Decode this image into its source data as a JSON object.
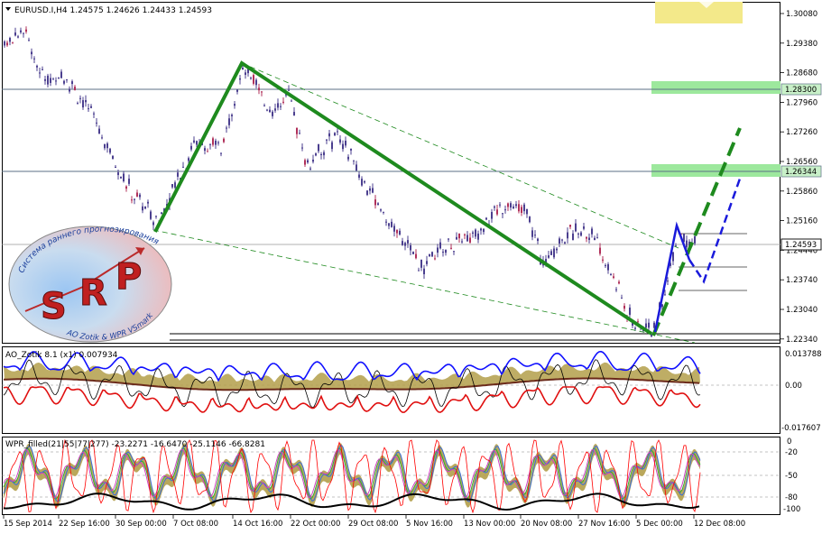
{
  "colors": {
    "background": "#ffffff",
    "grid_line": "#5b6f85",
    "candle": "#4b3f8f",
    "green_trend": "#1e8a1e",
    "blue_projection": "#1a1adb",
    "resistance_zone": "#9de89d",
    "zone_yellow": "#f3e98a",
    "ao_blue": "#1010ff",
    "ao_red": "#e01010",
    "ao_fill": "#b39f4a",
    "wpr_black": "#000000",
    "wpr_red": "#ff0000",
    "wpr_green": "#33aa33",
    "price_label_bg": "#c8f0c8"
  },
  "main_panel": {
    "header": "EURUSD.I,H4  1.24575 1.24626 1.24433 1.24593",
    "price_axis_labels": [
      "1.30080",
      "1.29380",
      "1.28680",
      "1.27960",
      "1.27260",
      "1.26560",
      "1.25860",
      "1.25160",
      "1.24440",
      "1.23740",
      "1.23040",
      "1.22340"
    ],
    "tagged_prices": {
      "level_1": "1.28300",
      "level_2": "1.26344",
      "current": "1.24593"
    },
    "logo": {
      "top_text": "Система раннего прогнозирования",
      "letters": [
        "S",
        "R",
        "P"
      ],
      "bottom_text": "AO Zotik & WPR VSmark",
      "icon": "srp-logo-icon"
    }
  },
  "ao_panel": {
    "header": "AO_Zotik 8.1 (x1) 0.007934",
    "axis_labels": [
      "0.013788",
      "0.00",
      "-0.017607"
    ]
  },
  "wpr_panel": {
    "header": "WPR_filled(21|55|77|277)  -23.2271 -16.6470 -25.1146 -66.8281",
    "axis_labels": [
      "0",
      "-20",
      "-50",
      "-80",
      "-100"
    ]
  },
  "time_axis": {
    "labels": [
      "15 Sep 2014",
      "22 Sep 16:00",
      "30 Sep 00:00",
      "7 Oct 08:00",
      "14 Oct 16:00",
      "22 Oct 00:00",
      "29 Oct 08:00",
      "5 Nov 16:00",
      "13 Nov 00:00",
      "20 Nov 08:00",
      "27 Nov 16:00",
      "5 Dec 00:00",
      "12 Dec 08:00"
    ]
  },
  "chart_data": {
    "type": "line",
    "symbol": "EURUSD.I",
    "timeframe": "H4",
    "last_bar": {
      "open": 1.24575,
      "high": 1.24626,
      "low": 1.24433,
      "close": 1.24593
    },
    "ylim": [
      1.2234,
      1.3008
    ],
    "anchor_price_points": [
      {
        "x": "15 Sep 2014",
        "y": 1.294
      },
      {
        "x": "22 Sep 16:00",
        "y": 1.2845
      },
      {
        "x": "30 Sep 00:00",
        "y": 1.26
      },
      {
        "x": "7 Oct 08:00",
        "y": 1.273
      },
      {
        "x": "14 Oct 16:00",
        "y": 1.278
      },
      {
        "x": "22 Oct 00:00",
        "y": 1.266
      },
      {
        "x": "29 Oct 08:00",
        "y": 1.26
      },
      {
        "x": "5 Nov 16:00",
        "y": 1.242
      },
      {
        "x": "13 Nov 00:00",
        "y": 1.247
      },
      {
        "x": "20 Nov 08:00",
        "y": 1.243
      },
      {
        "x": "27 Nov 16:00",
        "y": 1.246
      },
      {
        "x": "5 Dec 00:00",
        "y": 1.23
      },
      {
        "x": "12 Dec 08:00",
        "y": 1.2459
      }
    ],
    "horizontal_levels": [
      1.283,
      1.26344
    ]
  }
}
